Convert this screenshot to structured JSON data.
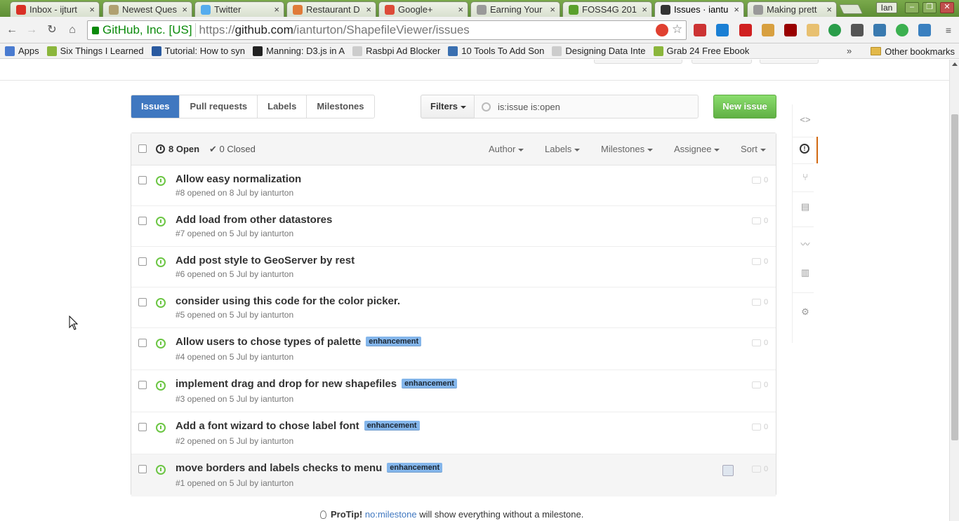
{
  "browser": {
    "tabs": [
      {
        "title": "Inbox - ijturt",
        "icon": "gmail-icon",
        "color": "#d93025"
      },
      {
        "title": "Newest Ques",
        "icon": "stackexchange-icon",
        "color": "#b0a070"
      },
      {
        "title": "Twitter",
        "icon": "twitter-icon",
        "color": "#55acee"
      },
      {
        "title": "Restaurant D",
        "icon": "restaurant-icon",
        "color": "#e07b39"
      },
      {
        "title": "Google+",
        "icon": "googleplus-icon",
        "color": "#dd4b39"
      },
      {
        "title": "Earning Your",
        "icon": "document-icon",
        "color": "#999999"
      },
      {
        "title": "FOSS4G 201",
        "icon": "foss4g-icon",
        "color": "#5aa02c"
      },
      {
        "title": "Issues · iantu",
        "icon": "github-icon",
        "color": "#333333"
      },
      {
        "title": "Making prett",
        "icon": "document-icon",
        "color": "#999999"
      }
    ],
    "user": "Ian",
    "window_controls": {
      "minimize": "–",
      "restore": "❐",
      "close": "✕"
    },
    "secure_label": "GitHub, Inc. [US]",
    "url_scheme": "https://",
    "url_host": "github.com",
    "url_path": "/ianturton/ShapefileViewer/issues",
    "bookmarks": [
      {
        "label": "Apps",
        "color": "#4a7bd0"
      },
      {
        "label": "Six Things I Learned",
        "color": "#8bb63c"
      },
      {
        "label": "Tutorial: How to syn",
        "color": "#2a5aa0"
      },
      {
        "label": "Manning: D3.js in A",
        "color": "#222222"
      },
      {
        "label": "Rasbpi Ad Blocker",
        "color": "#cccccc"
      },
      {
        "label": "10 Tools To Add Son",
        "color": "#3a6fb0"
      },
      {
        "label": "Designing Data Inte",
        "color": "#cccccc"
      },
      {
        "label": "Grab 24 Free Ebook",
        "color": "#8bb63c"
      }
    ],
    "bookmarks_more": "»",
    "other_bookmarks": "Other bookmarks"
  },
  "subnav": {
    "issues": "Issues",
    "pulls": "Pull requests",
    "labels": "Labels",
    "milestones": "Milestones"
  },
  "filters_label": "Filters",
  "search_value": "is:issue is:open",
  "new_issue_label": "New issue",
  "states": {
    "open": "8 Open",
    "closed": "0 Closed"
  },
  "header_filters": [
    "Author",
    "Labels",
    "Milestones",
    "Assignee",
    "Sort"
  ],
  "issues": [
    {
      "title": "Allow easy normalization",
      "meta": "#8 opened on 8 Jul by ianturton",
      "label": "",
      "comments": "0"
    },
    {
      "title": "Add load from other datastores",
      "meta": "#7 opened on 5 Jul by ianturton",
      "label": "",
      "comments": "0"
    },
    {
      "title": "Add post style to GeoServer by rest",
      "meta": "#6 opened on 5 Jul by ianturton",
      "label": "",
      "comments": "0"
    },
    {
      "title": "consider using this code for the color picker.",
      "meta": "#5 opened on 5 Jul by ianturton",
      "label": "",
      "comments": "0"
    },
    {
      "title": "Allow users to chose types of palette",
      "meta": "#4 opened on 5 Jul by ianturton",
      "label": "enhancement",
      "comments": "0"
    },
    {
      "title": "implement drag and drop for new shapefiles",
      "meta": "#3 opened on 5 Jul by ianturton",
      "label": "enhancement",
      "comments": "0"
    },
    {
      "title": "Add a font wizard to chose label font",
      "meta": "#2 opened on 5 Jul by ianturton",
      "label": "enhancement",
      "comments": "0"
    },
    {
      "title": "move borders and labels checks to menu",
      "meta": "#1 opened on 5 Jul by ianturton",
      "label": "enhancement",
      "comments": "0"
    }
  ],
  "protip": {
    "prefix": "ProTip!",
    "link": "no:milestone",
    "suffix": "will show everything without a milestone."
  },
  "colors": {
    "accent": "#4078c0",
    "open_green": "#6cc644",
    "new_issue_green": "#60b044",
    "label_blue": "#84b6eb",
    "active_marker": "#d26911"
  }
}
